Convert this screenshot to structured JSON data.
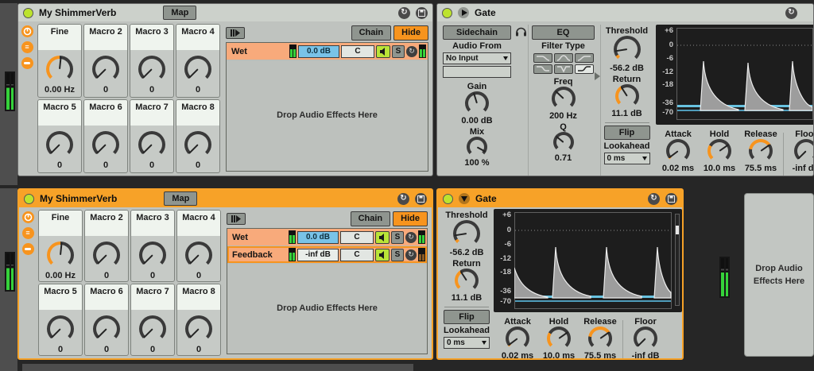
{
  "icons": {
    "hot_swap": "↻",
    "chain_list": "≡"
  },
  "rack_top": {
    "title": "My ShimmerVerb",
    "map": "Map",
    "macros": [
      {
        "name": "Fine",
        "value": "0.00 Hz",
        "knob": {
          "arc": [
            0,
            135
          ],
          "needle": 141
        }
      },
      {
        "name": "Macro 2",
        "value": "0",
        "knob": {
          "arc": null,
          "needle": 0
        }
      },
      {
        "name": "Macro 3",
        "value": "0",
        "knob": {
          "arc": null,
          "needle": 0
        }
      },
      {
        "name": "Macro 4",
        "value": "0",
        "knob": {
          "arc": null,
          "needle": 0
        }
      },
      {
        "name": "Macro 5",
        "value": "0",
        "knob": {
          "arc": null,
          "needle": 0
        }
      },
      {
        "name": "Macro 6",
        "value": "0",
        "knob": {
          "arc": null,
          "needle": 0
        }
      },
      {
        "name": "Macro 7",
        "value": "0",
        "knob": {
          "arc": null,
          "needle": 0
        }
      },
      {
        "name": "Macro 8",
        "value": "0",
        "knob": {
          "arc": null,
          "needle": 0
        }
      }
    ],
    "chain_button": "Chain",
    "hide_button": "Hide",
    "chains": [
      {
        "name": "Wet",
        "volume": "0.0 dB",
        "pan": "C",
        "solo": "S"
      }
    ],
    "drop_text": "Drop Audio Effects Here"
  },
  "gate_top": {
    "title": "Gate",
    "sidechain_button": "Sidechain",
    "eq_button": "EQ",
    "audio_from_label": "Audio From",
    "audio_from_value": "No Input",
    "gain": {
      "label": "Gain",
      "value": "0.00 dB",
      "knob": {
        "arc": null,
        "needle": 118
      }
    },
    "mix": {
      "label": "Mix",
      "value": "100 %",
      "knob": {
        "arc": null,
        "needle": 253
      }
    },
    "filter_type_label": "Filter Type",
    "freq": {
      "label": "Freq",
      "value": "200 Hz",
      "knob": {
        "arc": null,
        "needle": 88
      }
    },
    "q": {
      "label": "Q",
      "value": "0.71",
      "knob": {
        "arc": null,
        "needle": 84
      }
    },
    "threshold": {
      "label": "Threshold",
      "value": "-56.2 dB",
      "knob": {
        "arc": [
          0,
          14
        ],
        "needle": 36
      }
    },
    "return": {
      "label": "Return",
      "value": "11.1 dB",
      "knob": {
        "arc": [
          0,
          102
        ],
        "needle": 102
      }
    },
    "flip_button": "Flip",
    "lookahead_label": "Lookahead",
    "lookahead_value": "0 ms",
    "graph_ticks": [
      "+6",
      "0",
      "-6",
      "-12",
      "-18",
      "-36",
      "-70"
    ],
    "attack": {
      "label": "Attack",
      "value": "0.02 ms",
      "knob": {
        "arc": [
          0,
          8
        ],
        "needle": 8
      }
    },
    "hold": {
      "label": "Hold",
      "value": "10.0 ms",
      "knob": {
        "arc": [
          0,
          75
        ],
        "needle": 190
      }
    },
    "release": {
      "label": "Release",
      "value": "75.5 ms",
      "knob": {
        "arc": [
          55,
          190
        ],
        "needle": 190
      }
    },
    "floor": {
      "label": "Floor",
      "value": "-inf dB",
      "knob": {
        "arc": null,
        "needle": 0
      }
    }
  },
  "rack_bottom": {
    "title": "My ShimmerVerb",
    "map": "Map",
    "macros": [
      {
        "name": "Fine",
        "value": "0.00 Hz",
        "knob": {
          "arc": [
            0,
            135
          ],
          "needle": 141
        }
      },
      {
        "name": "Macro 2",
        "value": "0",
        "knob": {
          "arc": null,
          "needle": 0
        }
      },
      {
        "name": "Macro 3",
        "value": "0",
        "knob": {
          "arc": null,
          "needle": 0
        }
      },
      {
        "name": "Macro 4",
        "value": "0",
        "knob": {
          "arc": null,
          "needle": 0
        }
      },
      {
        "name": "Macro 5",
        "value": "0",
        "knob": {
          "arc": null,
          "needle": 0
        }
      },
      {
        "name": "Macro 6",
        "value": "0",
        "knob": {
          "arc": null,
          "needle": 0
        }
      },
      {
        "name": "Macro 7",
        "value": "0",
        "knob": {
          "arc": null,
          "needle": 0
        }
      },
      {
        "name": "Macro 8",
        "value": "0",
        "knob": {
          "arc": null,
          "needle": 0
        }
      }
    ],
    "chain_button": "Chain",
    "hide_button": "Hide",
    "chains": [
      {
        "name": "Wet",
        "volume": "0.0 dB",
        "pan": "C",
        "solo": "S"
      },
      {
        "name": "Feedback",
        "volume": "-inf dB",
        "pan": "C",
        "solo": "S"
      }
    ],
    "drop_text": "Drop Audio Effects Here"
  },
  "gate_bottom": {
    "title": "Gate",
    "threshold": {
      "label": "Threshold",
      "value": "-56.2 dB",
      "knob": {
        "arc": [
          0,
          14
        ],
        "needle": 36
      }
    },
    "return": {
      "label": "Return",
      "value": "11.1 dB",
      "knob": {
        "arc": [
          0,
          102
        ],
        "needle": 102
      }
    },
    "flip_button": "Flip",
    "lookahead_label": "Lookahead",
    "lookahead_value": "0 ms",
    "graph_ticks": [
      "+6",
      "0",
      "-6",
      "-12",
      "-18",
      "-36",
      "-70"
    ],
    "attack": {
      "label": "Attack",
      "value": "0.02 ms",
      "knob": {
        "arc": [
          0,
          8
        ],
        "needle": 8
      }
    },
    "hold": {
      "label": "Hold",
      "value": "10.0 ms",
      "knob": {
        "arc": [
          0,
          75
        ],
        "needle": 190
      }
    },
    "release": {
      "label": "Release",
      "value": "75.5 ms",
      "knob": {
        "arc": [
          55,
          190
        ],
        "needle": 190
      }
    },
    "floor": {
      "label": "Floor",
      "value": "-inf dB",
      "knob": {
        "arc": null,
        "needle": 0
      }
    }
  },
  "drop_panel_text": "Drop Audio Effects Here"
}
